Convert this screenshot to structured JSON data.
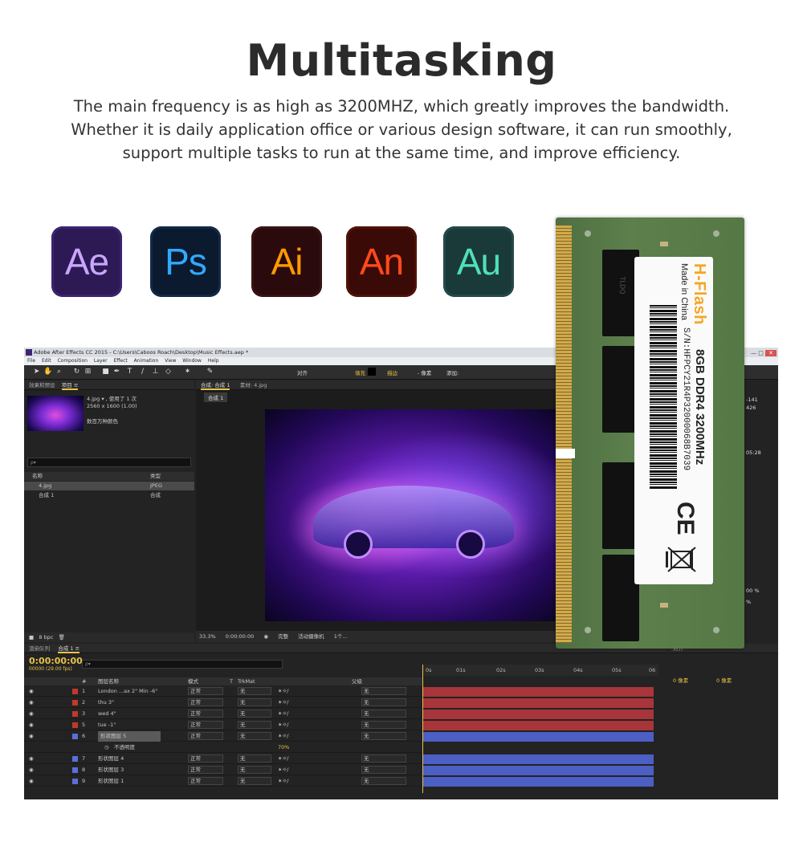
{
  "heading": {
    "title": "Multitasking",
    "lines": [
      "The main frequency is as high as 3200MHZ, which greatly improves the bandwidth.",
      "Whether it is daily application office or various design software, it can run smoothly,",
      "support multiple tasks to run at the same time, and improve efficiency."
    ]
  },
  "apps": [
    {
      "label": "Ae",
      "color": "#c9a6ff"
    },
    {
      "label": "Ps",
      "color": "#31a8ff"
    },
    {
      "label": "Ai",
      "color": "#ff9a00"
    },
    {
      "label": "An",
      "color": "#ff4a1a"
    },
    {
      "label": "Au",
      "color": "#4fe0b8"
    }
  ],
  "ae": {
    "title": "Adobe After Effects CC 2015 - C:\\Users\\Caboos Roach\\Desktop\\Music Effects.aep *",
    "menu": "File Edit Composition Layer Effect Animation View Window Help",
    "toolbar": {
      "snap": "对齐",
      "fill": "填充",
      "stroke": "描边",
      "px": "- 像素",
      "add": "添加:"
    },
    "project": {
      "tab1": "效果和预设",
      "tab2": "项目 ≡",
      "file": "4.jpg ▾ , 使用了 1 次",
      "dims": "2560 x 1600 (1.00)",
      "color": "数百万种颜色",
      "search": "ρ▾",
      "col_name": "名称",
      "col_type": "类型",
      "rows": [
        {
          "name": "4.jpg",
          "type": "JPEG"
        },
        {
          "name": "合成 1",
          "type": "合成"
        }
      ],
      "footer": "8 bpc"
    },
    "comp": {
      "tab": "合成: 合成 1",
      "tab_b": "素材: 4.jpg",
      "tab2": "合成 1",
      "zoom": "33.3%",
      "time": "0:00:00:00",
      "quality": "完整",
      "camera": "活动摄像机",
      "views": "1个..."
    },
    "right": {
      "v1": "-141",
      "v2": "426",
      "v3": "05:28",
      "v4": "00 %",
      "v5": "%"
    },
    "timeline": {
      "tab_render": "渲染队列",
      "tab_comp": "合成 1 ≡",
      "time": "0:00:00:00",
      "fps": "00000 (29.00 fps)",
      "search": "ρ▾",
      "col_num": "#",
      "col_name": "图层名称",
      "col_mode": "模式",
      "col_t": "T",
      "col_trk": "TrkMat",
      "col_parent": "父级",
      "ruler": [
        "0s",
        "01s",
        "02s",
        "03s",
        "04s",
        "05s",
        "06"
      ],
      "mode_label": "正常",
      "none_label": "无",
      "opacity_label": "不透明度",
      "opacity_value": "70%",
      "layers": [
        {
          "num": "1",
          "name": "London ...ax 2\" Min -6\"",
          "color": "#c0392b"
        },
        {
          "num": "2",
          "name": "thu 3\"",
          "color": "#c0392b"
        },
        {
          "num": "3",
          "name": "wed 4\"",
          "color": "#c0392b"
        },
        {
          "num": "5",
          "name": "tue -1\"",
          "color": "#c0392b"
        },
        {
          "num": "6",
          "name": "形状图层 5",
          "color": "#5a6fd8"
        },
        {
          "num": "7",
          "name": "形状图层 4",
          "color": "#5a6fd8"
        },
        {
          "num": "8",
          "name": "形状图层 3",
          "color": "#5a6fd8"
        },
        {
          "num": "9",
          "name": "形状图层 1",
          "color": "#5a6fd8"
        }
      ]
    },
    "align": {
      "tab": "对齐",
      "px": "0 像素"
    }
  },
  "ram": {
    "brand": "H-Flash",
    "origin": "Made in China",
    "spec": "8GB  DDR4 3200MHz",
    "serial": "S/N:HFPCY21R4P32000068B7039",
    "ce": "CE",
    "chip_text": "TLDQ"
  }
}
